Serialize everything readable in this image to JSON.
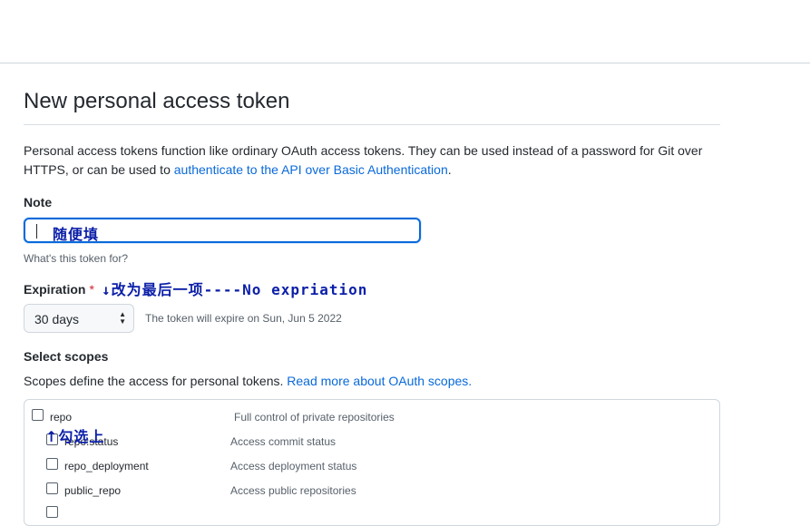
{
  "page": {
    "title": "New personal access token",
    "intro_text": "Personal access tokens function like ordinary OAuth access tokens. They can be used instead of a password for Git over HTTPS, or can be used to ",
    "intro_link": "authenticate to the API over Basic Authentication",
    "intro_end": "."
  },
  "note": {
    "label": "Note",
    "value": "随便填",
    "help": "What's this token for?"
  },
  "expiration": {
    "label": "Expiration",
    "required_mark": "*",
    "selected": "30 days",
    "expire_note": "The token will expire on Sun, Jun 5 2022",
    "annotation": "↓改为最后一项----No expriation"
  },
  "scopes": {
    "label": "Select scopes",
    "desc": "Scopes define the access for personal tokens. ",
    "link": "Read more about OAuth scopes.",
    "annotation": "↑勾选上",
    "items": [
      {
        "name": "repo",
        "desc": "Full control of private repositories"
      },
      {
        "name": "repo:status",
        "desc": "Access commit status"
      },
      {
        "name": "repo_deployment",
        "desc": "Access deployment status"
      },
      {
        "name": "public_repo",
        "desc": "Access public repositories"
      }
    ]
  },
  "colors": {
    "link": "#0969da",
    "focus_border": "#0969da",
    "annotation_ink": "#0b1fa8",
    "required": "#cf222e"
  }
}
